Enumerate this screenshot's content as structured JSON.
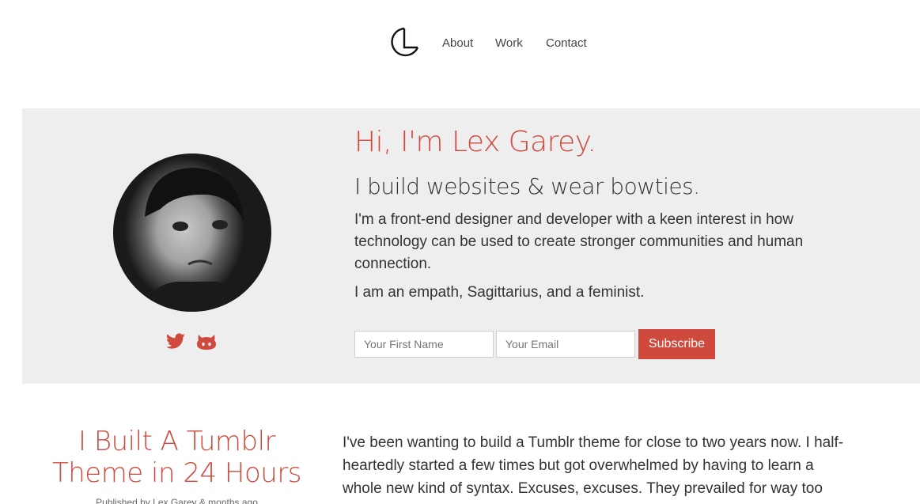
{
  "nav": {
    "logo_icon": "lg-monogram-logo",
    "links": [
      "About",
      "Work",
      "Contact"
    ]
  },
  "hero": {
    "title": "Hi, I'm Lex Garey.",
    "subtitle": "I build websites & wear bowties.",
    "bio": "I'm a front-end designer and developer with a keen interest in how technology can be used to create stronger communities and human connection.",
    "bio2": "I am an empath, Sagittarius, and a feminist.",
    "social_icons": [
      "twitter-icon",
      "github-icon"
    ],
    "form": {
      "first_name_placeholder": "Your First Name",
      "email_placeholder": "Your Email",
      "subscribe_label": "Subscribe"
    }
  },
  "post": {
    "title": "I Built A Tumblr Theme in 24 Hours",
    "meta": "Published by Lex Garey & months ago",
    "body": "I've been wanting to build a Tumblr theme for close to two years now. I half-heartedly started a few times but got overwhelmed by having to learn a whole new kind of syntax. Excuses, excuses. They prevailed for way too long,"
  },
  "colors": {
    "accent": "#d0493d",
    "hero_bg": "#eeeeee",
    "text": "#333333"
  }
}
